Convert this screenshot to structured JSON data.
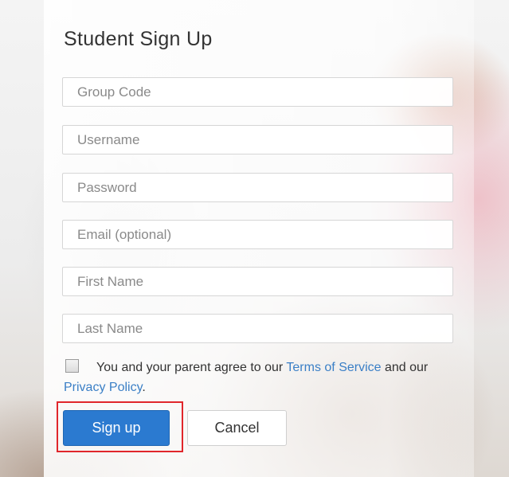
{
  "form": {
    "title": "Student Sign Up",
    "fields": [
      {
        "placeholder": "Group Code",
        "value": ""
      },
      {
        "placeholder": "Username",
        "value": ""
      },
      {
        "placeholder": "Password",
        "value": ""
      },
      {
        "placeholder": "Email (optional)",
        "value": ""
      },
      {
        "placeholder": "First Name",
        "value": ""
      },
      {
        "placeholder": "Last Name",
        "value": ""
      }
    ],
    "agreement": {
      "checked": false,
      "text_before": "You and your parent agree to our ",
      "terms_link": "Terms of Service",
      "text_middle": " and our ",
      "privacy_link": "Privacy Policy",
      "text_after": "."
    },
    "buttons": {
      "signup_label": "Sign up",
      "cancel_label": "Cancel"
    }
  },
  "colors": {
    "primary_button": "#2b7ad0",
    "link": "#3a7fc6",
    "highlight_box": "#e0262b"
  }
}
